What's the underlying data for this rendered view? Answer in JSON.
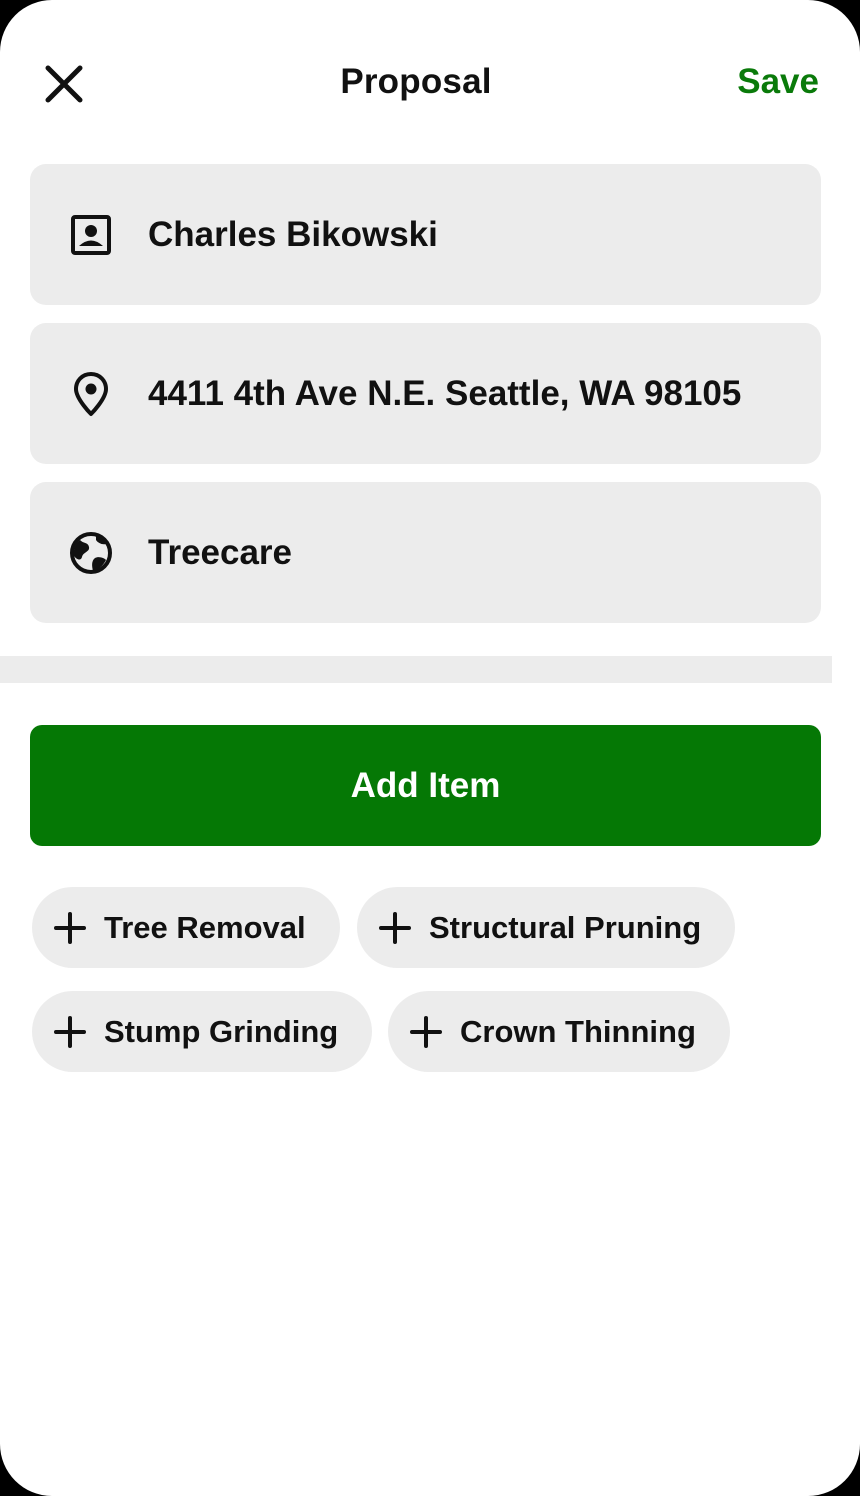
{
  "header": {
    "title": "Proposal",
    "save_label": "Save",
    "close_icon": "close-icon"
  },
  "fields": {
    "client": {
      "value": "Charles Bikowski",
      "icon": "contact-card-icon"
    },
    "address": {
      "value": "4411 4th Ave N.E. Seattle, WA 98105",
      "icon": "location-pin-icon"
    },
    "service": {
      "value": "Treecare",
      "icon": "globe-icon"
    }
  },
  "add_item": {
    "label": "Add Item"
  },
  "quick_items": [
    {
      "label": "Tree Removal"
    },
    {
      "label": "Structural Pruning"
    },
    {
      "label": "Stump Grinding"
    },
    {
      "label": "Crown Thinning"
    }
  ],
  "colors": {
    "accent": "#057805",
    "save_text": "#0a7a0a",
    "field_bg": "#ececec",
    "text": "#111111"
  }
}
